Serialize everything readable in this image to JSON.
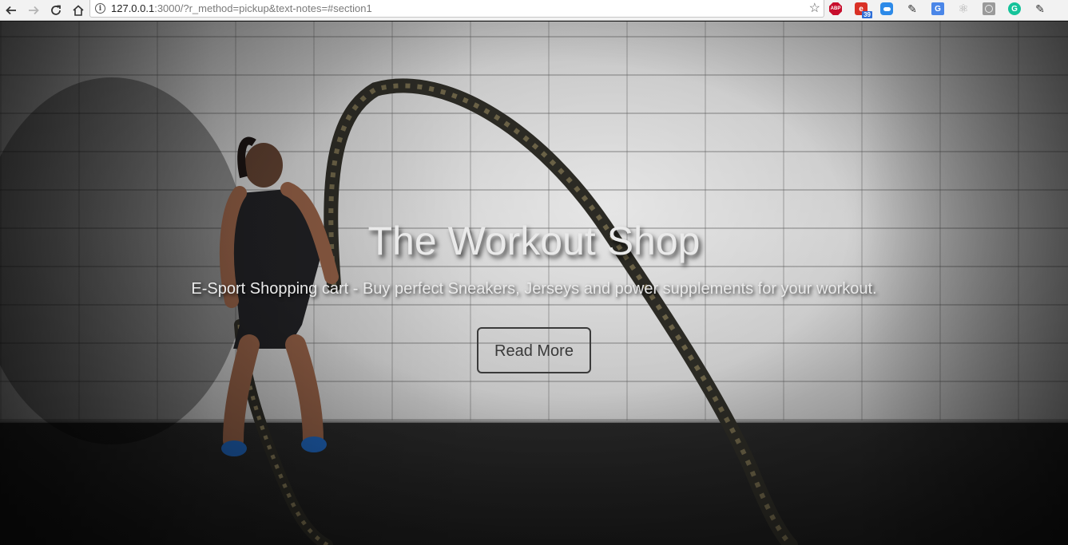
{
  "browser": {
    "url_host": "127.0.0.1",
    "url_rest": ":3000/?r_method=pickup&text-notes=#section1",
    "back_icon": "back-arrow-icon",
    "forward_icon": "forward-arrow-icon",
    "reload_icon": "reload-icon",
    "home_icon": "home-icon",
    "extensions": [
      {
        "name": "adblock-plus-icon",
        "text": "ABP"
      },
      {
        "name": "red-extension-icon",
        "badge": "39"
      },
      {
        "name": "cloud-extension-icon"
      },
      {
        "name": "eyedropper-icon"
      },
      {
        "name": "google-translate-icon"
      },
      {
        "name": "react-devtools-icon"
      },
      {
        "name": "grey-extension-icon"
      },
      {
        "name": "grammarly-icon"
      },
      {
        "name": "color-picker-icon"
      }
    ]
  },
  "hero": {
    "title": "The Workout Shop",
    "subtitle": "E-Sport Shopping cart - Buy perfect Sneakers, Jerseys and power supplements for your workout.",
    "cta_label": "Read More"
  }
}
